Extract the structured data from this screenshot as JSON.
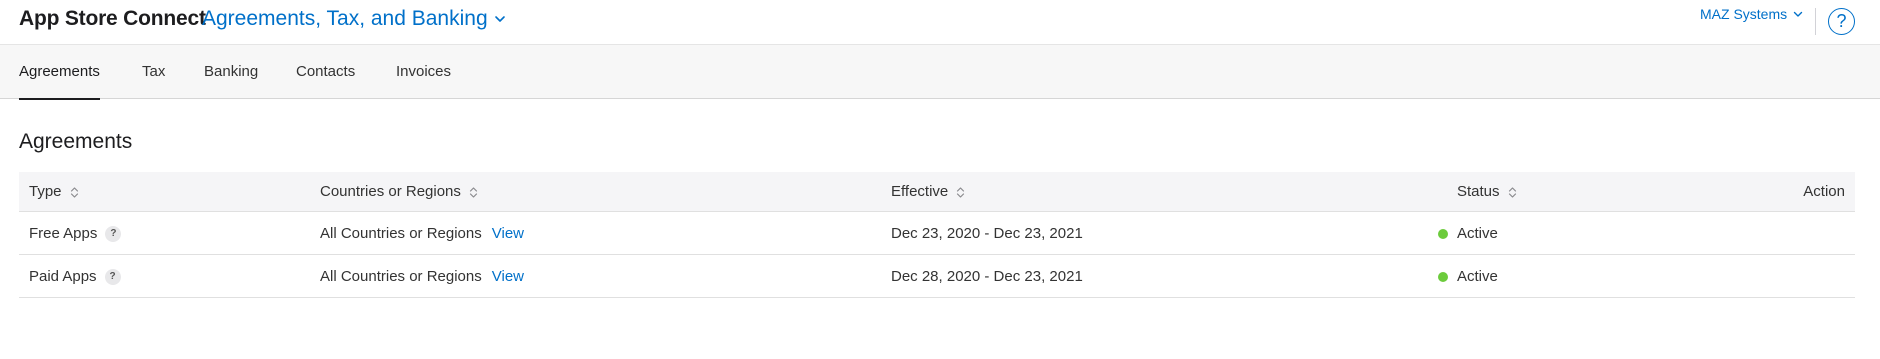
{
  "header": {
    "app_title": "App Store Connect",
    "section_title": "Agreements, Tax, and Banking",
    "account_name": "MAZ Systems",
    "help_label": "?"
  },
  "tabs": [
    {
      "label": "Agreements",
      "active": true
    },
    {
      "label": "Tax",
      "active": false
    },
    {
      "label": "Banking",
      "active": false
    },
    {
      "label": "Contacts",
      "active": false
    },
    {
      "label": "Invoices",
      "active": false
    }
  ],
  "main": {
    "title": "Agreements",
    "table": {
      "columns": [
        "Type",
        "Countries or Regions",
        "Effective",
        "Status",
        "Action"
      ],
      "rows": [
        {
          "type": "Free Apps",
          "regions": "All Countries or Regions",
          "view_label": "View",
          "effective": "Dec 23, 2020 - Dec 23, 2021",
          "status": "Active"
        },
        {
          "type": "Paid Apps",
          "regions": "All Countries or Regions",
          "view_label": "View",
          "effective": "Dec 28, 2020 - Dec 23, 2021",
          "status": "Active"
        }
      ]
    }
  },
  "colors": {
    "accent": "#0070c9",
    "status_active": "#6ccb3c"
  },
  "icons": {
    "section_chevron": "chevron-down-icon",
    "account_chevron": "chevron-down-icon",
    "help": "question-circle-icon",
    "sort": "sort-updown-icon",
    "info": "question-badge-icon",
    "status": "status-dot-icon"
  }
}
